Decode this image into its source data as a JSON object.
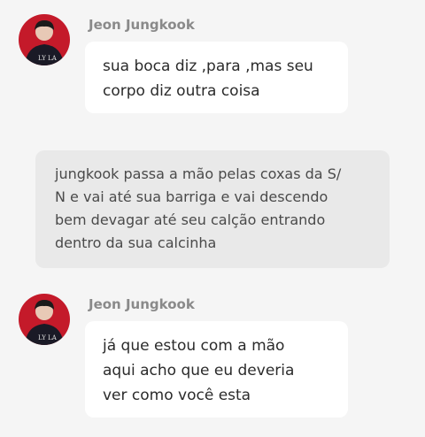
{
  "messages": [
    {
      "sender": "Jeon Jungkook",
      "avatar_icon": "jungkook-avatar",
      "lines": [
        "sua boca diz ,para ,mas seu",
        "corpo diz outra coisa"
      ]
    },
    {
      "narration_lines": [
        "jungkook passa a mão pelas coxas da S/",
        "N e vai até sua barriga e vai descendo",
        "bem devagar até seu calção entrando",
        "dentro da sua calcinha"
      ]
    },
    {
      "sender": "Jeon Jungkook",
      "avatar_icon": "jungkook-avatar",
      "lines": [
        "já que estou com a mão",
        "aqui acho que eu deveria",
        "ver como você esta"
      ]
    }
  ],
  "colors": {
    "background": "#f5f5f5",
    "bubble": "#ffffff",
    "narration_bubble": "#e9e9e9",
    "sender_name": "#8a8a8a",
    "avatar_bg": "#c41a2a"
  }
}
